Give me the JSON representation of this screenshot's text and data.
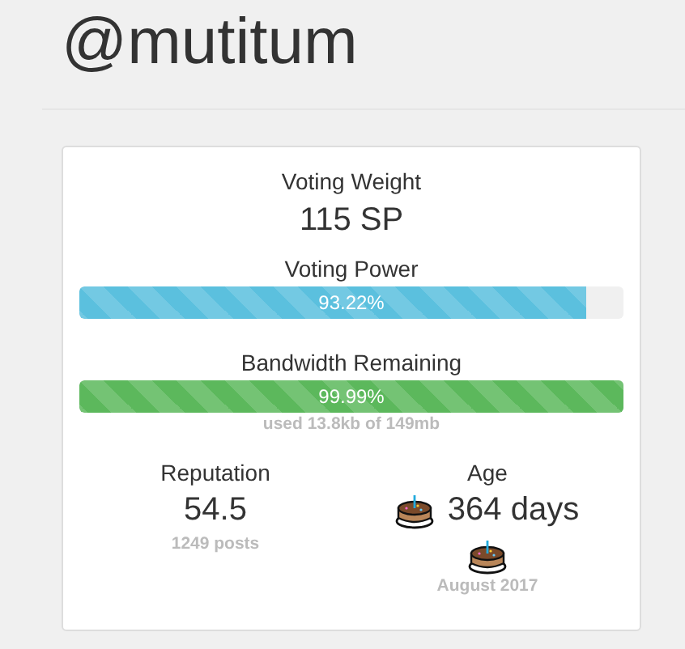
{
  "username": "@mutitum",
  "voting_weight": {
    "label": "Voting Weight",
    "value": "115 SP"
  },
  "meters": [
    {
      "label": "Voting Power",
      "reading": "93.22%",
      "level": 0.9322,
      "color": "#5bc0de"
    },
    {
      "label": "Bandwidth Remaining",
      "reading": "99.99%",
      "level": 0.9999,
      "color": "#5cb85c",
      "note": "used 13.8kb of 149mb"
    }
  ],
  "reputation": {
    "label": "Reputation",
    "value": "54.5",
    "note": "1249 posts"
  },
  "age": {
    "label": "Age",
    "value": "364 days",
    "note": "August 2017"
  }
}
